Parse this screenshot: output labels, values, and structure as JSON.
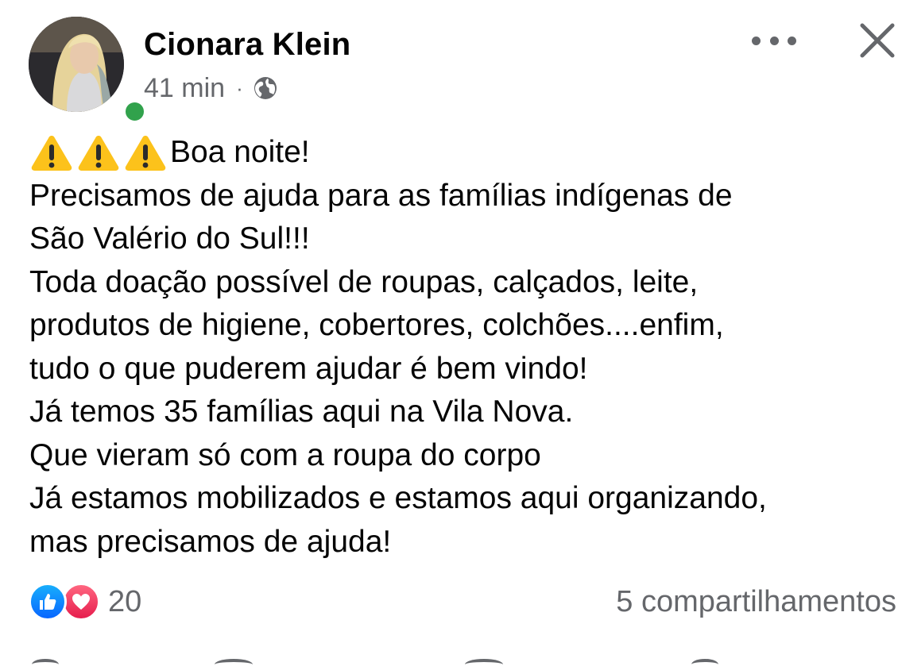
{
  "author": {
    "name": "Cionara Klein",
    "online": true,
    "online_color": "#31a24c"
  },
  "meta": {
    "time": "41 min",
    "separator": "·",
    "audience_icon": "globe-icon"
  },
  "header_actions": {
    "more_icon": "more-options-icon",
    "close_icon": "close-icon"
  },
  "post": {
    "warning_icon": "warning-sign-emoji",
    "lines": [
      "Boa noite!",
      "Precisamos de ajuda para as famílias indígenas de",
      "São Valério do Sul!!!",
      "Toda doação possível de roupas, calçados, leite,",
      "produtos de higiene, cobertores, colchões....enfim,",
      "tudo o que puderem ajudar é bem vindo!",
      "Já temos 35 famílias aqui na Vila Nova.",
      "Que vieram só com a roupa do corpo",
      "Já estamos mobilizados e estamos aqui organizando,",
      "mas precisamos de ajuda!"
    ]
  },
  "footer": {
    "reaction_icons": [
      "like-icon",
      "love-icon"
    ],
    "reaction_count": "20",
    "shares": "5 compartilhamentos"
  },
  "colors": {
    "text": "#050505",
    "secondary": "#65676b",
    "like": "#0866ff",
    "love": "#e61e4d"
  }
}
